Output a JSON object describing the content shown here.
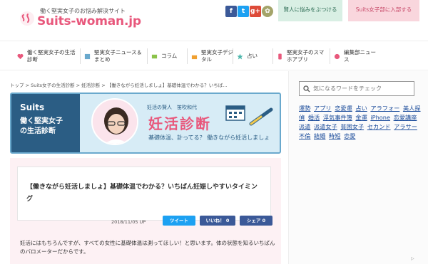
{
  "header": {
    "tagline": "働く堅実女子のお悩み解決サイト",
    "logo": "Suits-woman.jp",
    "social": [
      "f",
      "t",
      "g+",
      "✿"
    ],
    "button_consult": "賢人に悩みをぶつける",
    "button_join": "Suits女子部に入部する"
  },
  "nav": {
    "items": [
      "働く堅実女子の生活診断",
      "堅実女子ニュース＆まとめ",
      "コラム",
      "堅実女子デジタル",
      "占い",
      "堅実女子のスマホアプリ",
      "編集部ニュース"
    ]
  },
  "breadcrumb": "トップ  >  Suits女子の生活診断  >  妊活診断  >  【働きながら妊活しましょ】基礎体温でわかる？いちば…",
  "banner": {
    "logo": "Suits",
    "subtitle_line1": "働く堅実女子",
    "subtitle_line2": "の生活診断",
    "person": "妊活の賢人　笛吹和代",
    "title": "妊活診断",
    "sub": "基礎体温、計ってる？ 働きながら妊活しましょ"
  },
  "article": {
    "title": "【働きながら妊活しましょ】基礎体温でわかる？いちばん妊娠しやすいタイミング",
    "date": "2018/11/05 UP",
    "share_tweet": "ツイート",
    "share_like": "いいね！ 0",
    "share_share": "シェア 0",
    "body": "妊活にはもちろんですが、すべての女性に基礎体温は測ってほしい！と思います。体の状態を知るいちばんのバロメーターだからです。"
  },
  "sidebar": {
    "search_placeholder": "気になるワードをチェック",
    "tags": [
      "運勢",
      "アプリ",
      "恋愛運",
      "占い",
      "アラフォー",
      "美人探偵",
      "婚活",
      "浮気事件簿",
      "金運",
      "iPhone",
      "恋愛講座",
      "派遣",
      "派遣女子",
      "貧困女子",
      "セカンド",
      "アラサー",
      "不倫",
      "結婚",
      "時短",
      "恋愛"
    ]
  },
  "ad": "▷",
  "colors": {
    "brand": "#e8587c",
    "navy": "#2b5d84",
    "link": "#1a4b9a"
  }
}
